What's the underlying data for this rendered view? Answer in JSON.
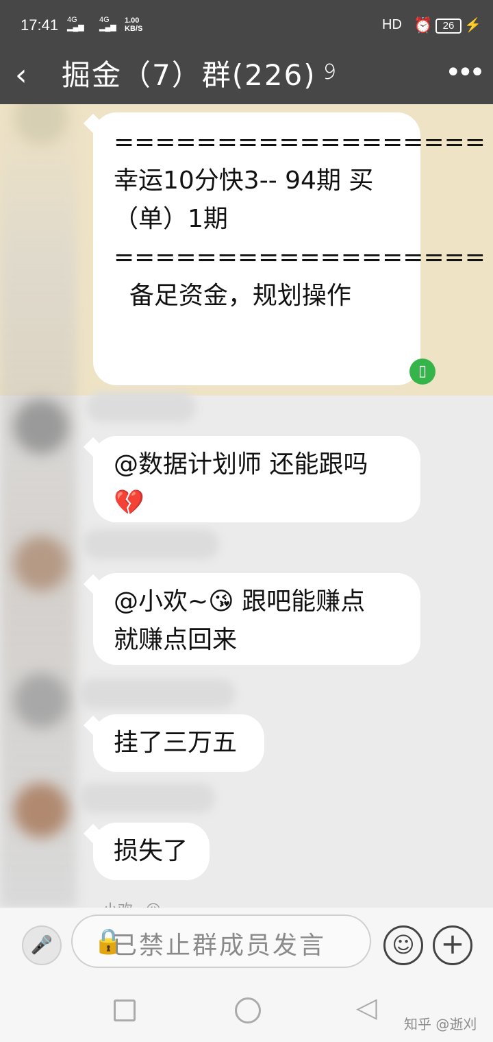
{
  "status_bar": {
    "time": "17:41",
    "signal_1": "4G",
    "signal_2": "4G",
    "net_speed_value": "1.00",
    "net_speed_unit": "KB/S",
    "hd_label": "HD",
    "alarm_icon": "alarm-clock-icon",
    "battery_level": "26",
    "charging_icon": "bolt-icon"
  },
  "header": {
    "back_icon": "chevron-left-icon",
    "title": "掘金（7）群(226)",
    "ear_icon": "ear-icon",
    "more_icon": "more-dots-icon"
  },
  "messages": [
    {
      "lines": [
        "==================",
        "",
        "幸运10分快3-- 94期 买",
        "（单）1期",
        "",
        "==================",
        "  备足资金，规划操作"
      ],
      "highlighted": true
    },
    {
      "lines": [
        "@数据计划师 还能跟吗",
        "💔"
      ]
    },
    {
      "lines": [
        "@小欢~😘 跟吧能赚点",
        "就赚点回来"
      ]
    },
    {
      "lines": [
        "挂了三万五"
      ]
    },
    {
      "lines": [
        "损失了"
      ]
    }
  ],
  "next_message_preview": "小欢~😥",
  "input_bar": {
    "placeholder": "已禁止群成员发言",
    "mic_icon": "microphone-icon",
    "lock_icon": "lock-icon",
    "emoji_icon": "smiley-icon",
    "plus_icon": "plus-icon"
  },
  "watermark": "知乎 @逝刈",
  "colors": {
    "header_bg": "#474747",
    "chat_bg": "#ebebeb",
    "highlight_bg": "#efe3c6",
    "bubble_bg": "#ffffff",
    "vibrate_badge": "#35b449"
  }
}
